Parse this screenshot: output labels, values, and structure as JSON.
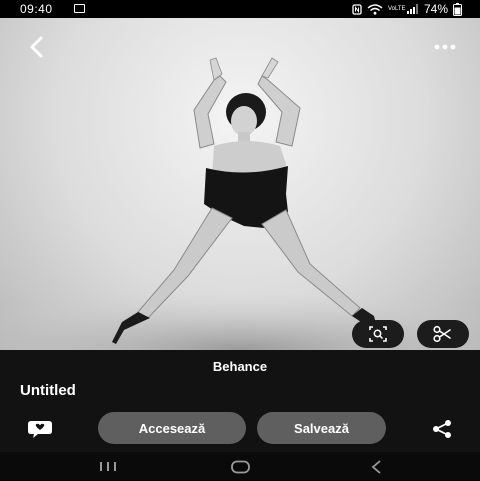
{
  "status_bar": {
    "time": "09:40",
    "battery": "74%",
    "network_label": "VoLTE",
    "icons": [
      "gallery-icon",
      "nfc-icon",
      "wifi-icon",
      "signal-icon",
      "battery-icon"
    ]
  },
  "viewer": {
    "toolbar_icons": [
      "back-arrow-icon",
      "more-options-icon"
    ],
    "image_actions": [
      "lens-search-icon",
      "scissors-icon"
    ]
  },
  "pin": {
    "source": "Behance",
    "title": "Untitled",
    "visit_label": "Accesează",
    "save_label": "Salvează",
    "icons": [
      "comment-icon",
      "share-icon"
    ]
  },
  "nav_bar": {
    "icons": [
      "recents-icon",
      "home-icon",
      "back-icon"
    ]
  },
  "colors": {
    "background": "#000000",
    "panel": "#121212",
    "pill_button": "#5f5f5f",
    "text": "#ffffff"
  }
}
